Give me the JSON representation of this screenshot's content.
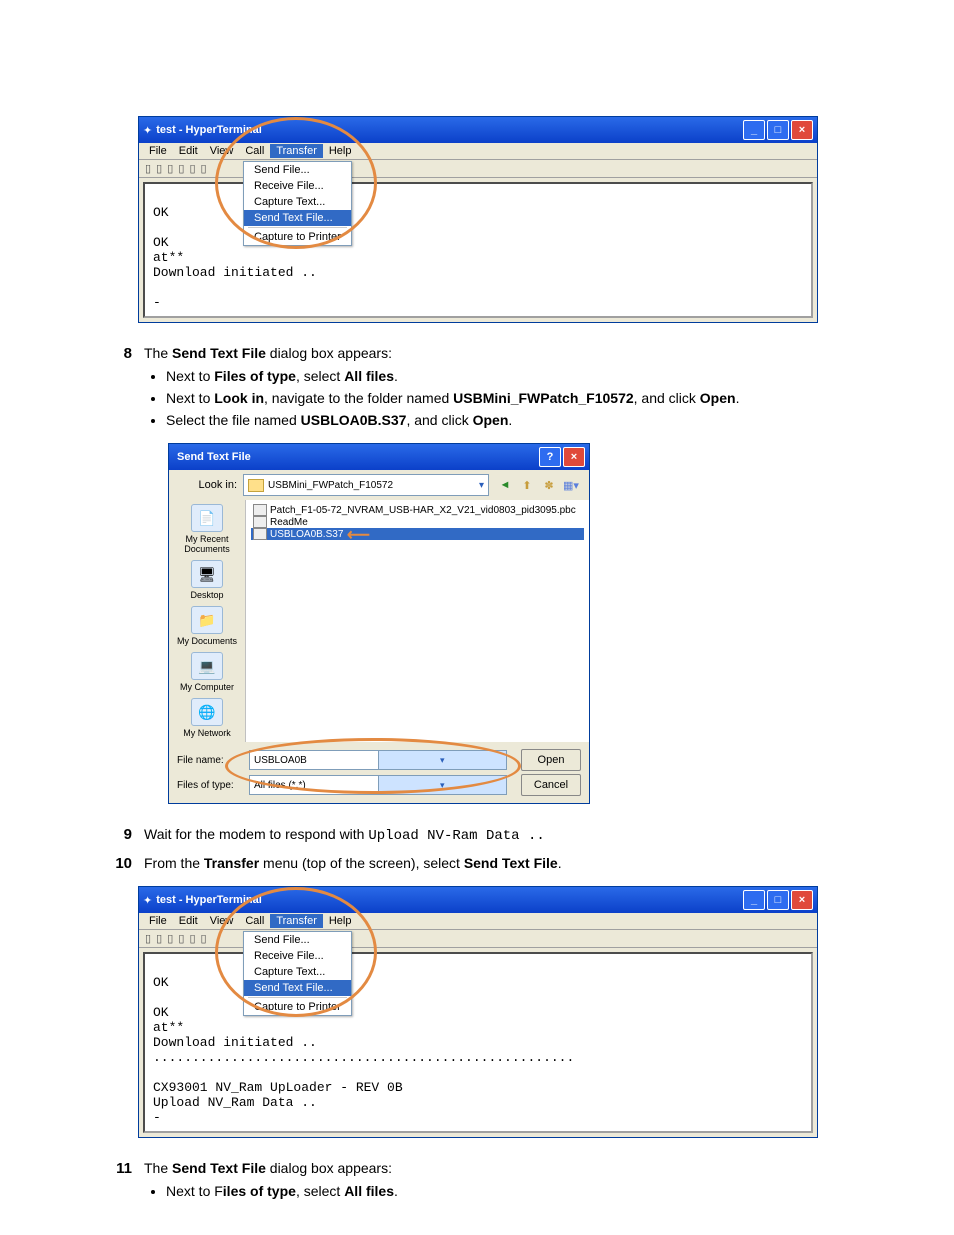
{
  "hyperterm": {
    "title": "test - HyperTerminal",
    "menus": {
      "file": "File",
      "edit": "Edit",
      "view": "View",
      "call": "Call",
      "transfer": "Transfer",
      "help": "Help"
    },
    "drop": {
      "send_file": "Send File...",
      "receive_file": "Receive File...",
      "capture_text": "Capture Text...",
      "send_text_file": "Send Text File...",
      "capture_printer": "Capture to Printer"
    },
    "term1": "\nOK\n\nOK\nat**\nDownload initiated ..\n\n-",
    "term2": "\nOK\n\nOK\nat**\nDownload initiated ..\n......................................................\n\nCX93001 NV_Ram UpLoader - REV 0B\nUpload NV_Ram Data ..\n-"
  },
  "step8": {
    "num": "8",
    "lead_a": "The ",
    "lead_b": "Send Text File",
    "lead_c": " dialog box appears:",
    "b1_a": "Next to ",
    "b1_b": "Files of type",
    "b1_c": ", select ",
    "b1_d": "All files",
    "b1_e": ".",
    "b2_a": "Next to ",
    "b2_b": "Look in",
    "b2_c": ", navigate to the folder named ",
    "b2_d": "USBMini_FWPatch_F10572",
    "b2_e": ", and click ",
    "b2_f": "Open",
    "b2_g": ".",
    "b3_a": "Select the file named ",
    "b3_b": "USBLOA0B.S37",
    "b3_c": ", and click ",
    "b3_d": "Open",
    "b3_e": "."
  },
  "dlg": {
    "title": "Send Text File",
    "lookin_label": "Look in:",
    "lookin_value": "USBMini_FWPatch_F10572",
    "files": {
      "f1": "Patch_F1-05-72_NVRAM_USB-HAR_X2_V21_vid0803_pid3095.pbc",
      "f2": "ReadMe",
      "f3": "USBLOA0B.S37"
    },
    "places": {
      "recent": "My Recent Documents",
      "desktop": "Desktop",
      "mydocs": "My Documents",
      "mycomp": "My Computer",
      "mynet": "My Network"
    },
    "filename_label": "File name:",
    "filename_value": "USBLOA0B",
    "filetype_label": "Files of type:",
    "filetype_value": "All files (*.*)",
    "open": "Open",
    "cancel": "Cancel"
  },
  "step9": {
    "num": "9",
    "a": "Wait for the modem to respond with ",
    "code": "Upload NV-Ram Data ..",
    "b": ""
  },
  "step10": {
    "num": "10",
    "a": "From the ",
    "b": "Transfer",
    "c": " menu (top of the screen), select ",
    "d": "Send Text File",
    "e": "."
  },
  "step11": {
    "num": "11",
    "lead_a": "The ",
    "lead_b": "Send Text File",
    "lead_c": " dialog box appears:",
    "b1_a": "Next to F",
    "b1_b": "iles of type",
    "b1_c": ", select ",
    "b1_d": "All files",
    "b1_e": "."
  }
}
